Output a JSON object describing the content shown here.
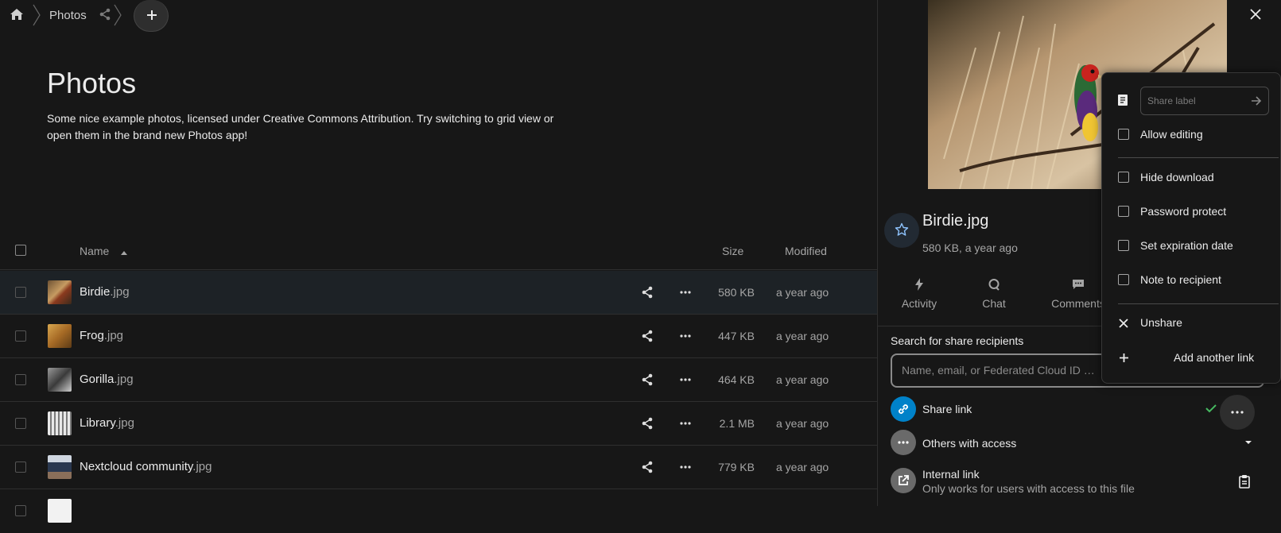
{
  "breadcrumb": {
    "home": "home-icon",
    "folder": "Photos"
  },
  "folder": {
    "title": "Photos",
    "description": "Some nice example photos, licensed under Creative Commons Attribution. Try switching to grid view or open them in the brand new Photos app!"
  },
  "table": {
    "headers": {
      "name": "Name",
      "size": "Size",
      "modified": "Modified"
    },
    "rows": [
      {
        "base": "Birdie",
        "ext": ".jpg",
        "size": "580 KB",
        "modified": "a year ago",
        "selected": true
      },
      {
        "base": "Frog",
        "ext": ".jpg",
        "size": "447 KB",
        "modified": "a year ago"
      },
      {
        "base": "Gorilla",
        "ext": ".jpg",
        "size": "464 KB",
        "modified": "a year ago"
      },
      {
        "base": "Library",
        "ext": ".jpg",
        "size": "2.1 MB",
        "modified": "a year ago"
      },
      {
        "base": "Nextcloud community",
        "ext": ".jpg",
        "size": "779 KB",
        "modified": "a year ago"
      }
    ]
  },
  "sidebar": {
    "filename": "Birdie.jpg",
    "meta": "580 KB, a year ago",
    "tabs": [
      "Activity",
      "Chat",
      "Comments"
    ],
    "search_label": "Search for share recipients",
    "search_placeholder": "Name, email, or Federated Cloud ID …",
    "share_link": "Share link",
    "others_access": "Others with access",
    "internal_link": "Internal link",
    "internal_link_sub": "Only works for users with access to this file"
  },
  "menu": {
    "label_placeholder": "Share label",
    "allow_editing": "Allow editing",
    "hide_download": "Hide download",
    "password_protect": "Password protect",
    "set_expiration": "Set expiration date",
    "note_to_recipient": "Note to recipient",
    "unshare": "Unshare",
    "add_another_link": "Add another link"
  },
  "colors": {
    "accent": "#0082c9",
    "success": "#46ba61",
    "background": "#171717"
  }
}
